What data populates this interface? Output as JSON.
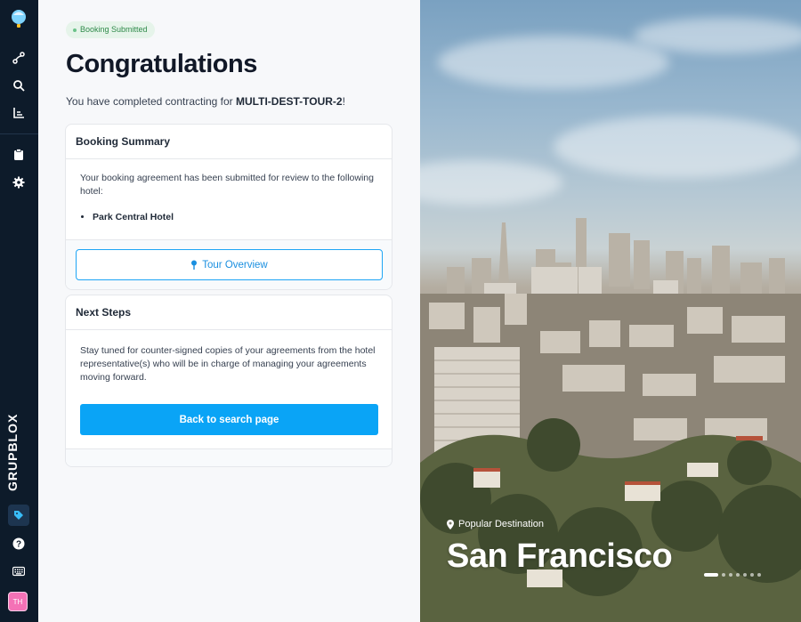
{
  "sidebar": {
    "brand": "GRUPBLOX",
    "avatar_initials": "TH",
    "icons": [
      "balloon-logo",
      "route-icon",
      "search-icon",
      "chart-icon",
      "clipboard-icon",
      "gear-icon",
      "tag-icon",
      "help-icon",
      "keyboard-icon"
    ]
  },
  "main": {
    "badge": "Booking Submitted",
    "title": "Congratulations",
    "subtitle_prefix": "You have completed contracting for ",
    "tour_code": "MULTI-DEST-TOUR-2",
    "subtitle_suffix": "!",
    "summary_card": {
      "title": "Booking Summary",
      "body": "Your booking agreement has been submitted for review to the following hotel:",
      "hotels": [
        "Park Central Hotel"
      ],
      "button_label": "Tour Overview"
    },
    "next_steps_card": {
      "title": "Next Steps",
      "body": "Stay tuned for counter-signed copies of your agreements from the hotel representative(s) who will be in charge of managing your agreements moving forward.",
      "button_label": "Back to search page"
    }
  },
  "hero": {
    "label": "Popular Destination",
    "city": "San Francisco",
    "carousel": {
      "count": 7,
      "active": 0
    }
  },
  "colors": {
    "accent": "#0aa4f6",
    "sidebar": "#0d1b2a",
    "badge_bg": "#e6f4ea",
    "badge_text": "#2f8a4a"
  }
}
